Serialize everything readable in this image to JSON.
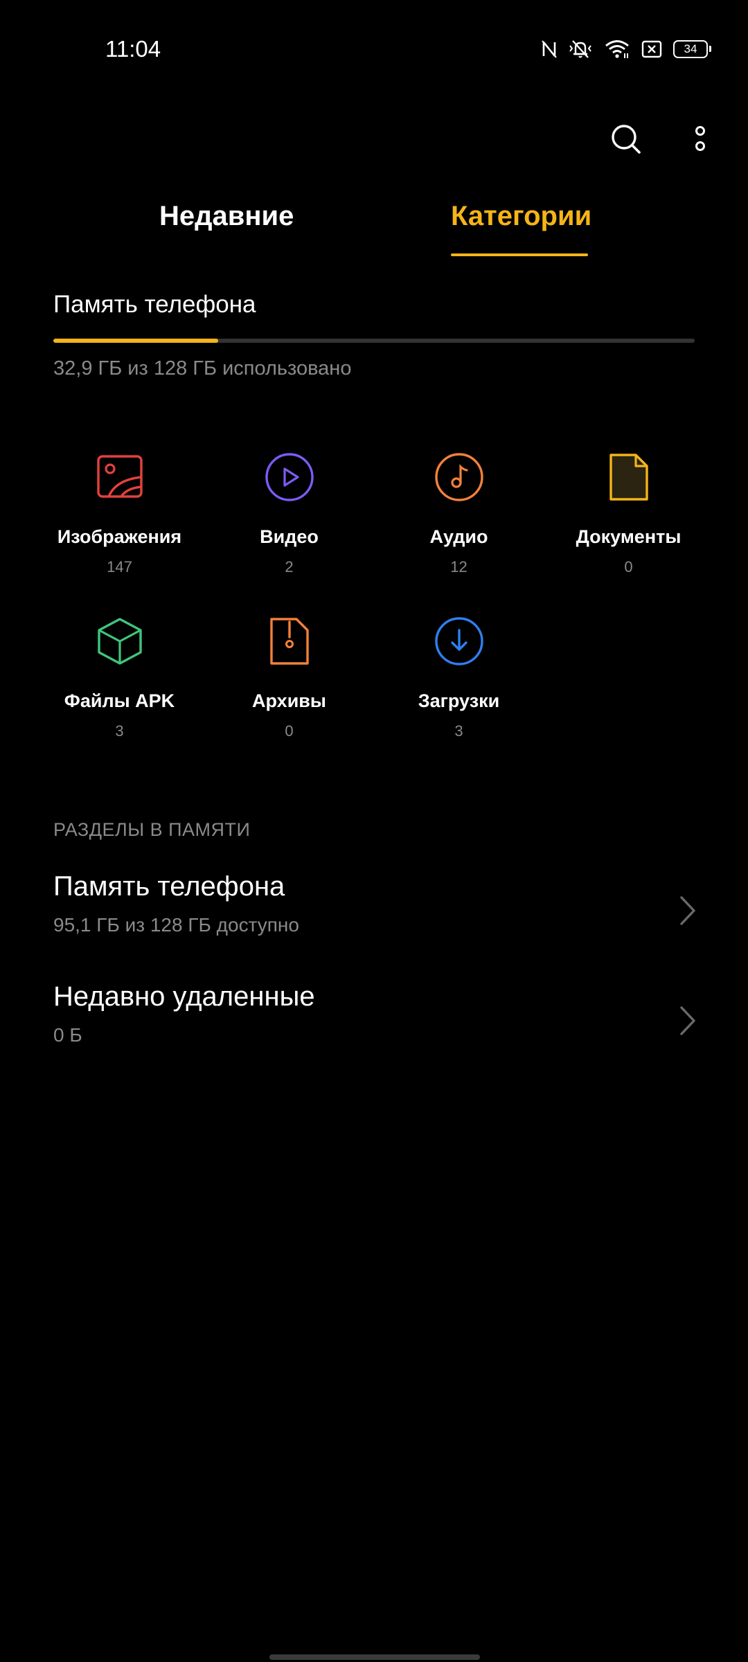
{
  "status_bar": {
    "time": "11:04",
    "battery": "34",
    "icons": [
      "nfc-icon",
      "mute-icon",
      "wifi-icon",
      "sim-off-icon",
      "battery-icon"
    ]
  },
  "toolbar": {
    "icons": [
      "search-icon",
      "more-vert-icon"
    ]
  },
  "tabs": [
    {
      "label": "Недавние",
      "active": false
    },
    {
      "label": "Категории",
      "active": true
    }
  ],
  "colors": {
    "accent": "#f5b418",
    "background": "#000000",
    "secondary_text": "#8a8a8a"
  },
  "storage": {
    "title": "Память телефона",
    "usage": "32,9 ГБ из 128 ГБ использовано",
    "used_fraction": 0.257
  },
  "categories": [
    {
      "label": "Изображения",
      "count": "147",
      "icon": "image-icon",
      "color": "#e2413e"
    },
    {
      "label": "Видео",
      "count": "2",
      "icon": "video-play-icon",
      "color": "#7b5cf5"
    },
    {
      "label": "Аудио",
      "count": "12",
      "icon": "music-note-icon",
      "color": "#f3813a"
    },
    {
      "label": "Документы",
      "count": "0",
      "icon": "document-icon",
      "color": "#f5b418"
    },
    {
      "label": "Файлы APK",
      "count": "3",
      "icon": "package-box-icon",
      "color": "#3fc67b"
    },
    {
      "label": "Архивы",
      "count": "0",
      "icon": "archive-zip-icon",
      "color": "#f3813a"
    },
    {
      "label": "Загрузки",
      "count": "3",
      "icon": "download-icon",
      "color": "#2f7fef"
    }
  ],
  "sections": {
    "header": "РАЗДЕЛЫ В ПАМЯТИ",
    "items": [
      {
        "title": "Память телефона",
        "subtitle": "95,1 ГБ из 128 ГБ доступно"
      },
      {
        "title": "Недавно удаленные",
        "subtitle": "0 Б"
      }
    ]
  }
}
